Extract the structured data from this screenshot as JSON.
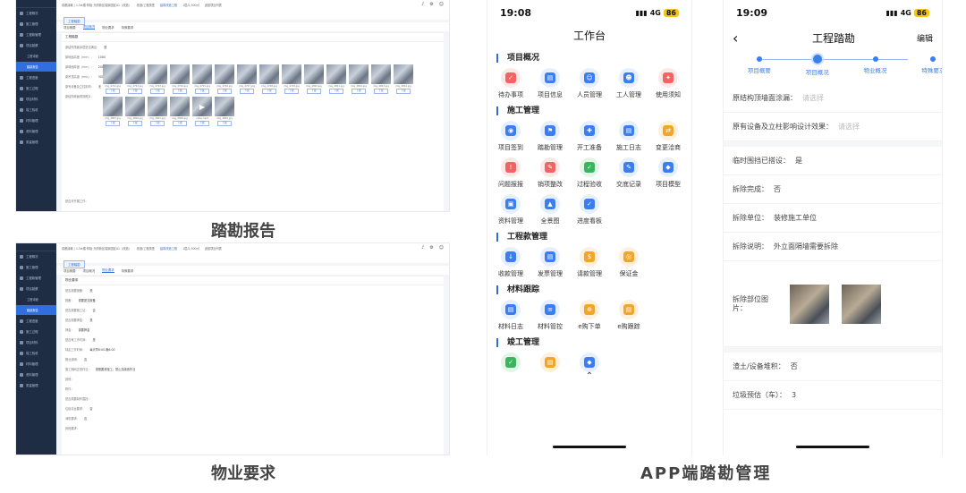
{
  "pc": {
    "sidebar_items": [
      "工程概况",
      "施工管理",
      "工程款管理",
      "项目勘察",
      "工程进度",
      "施工过程",
      "项目材料",
      "竣工验收",
      "材料管理",
      "资料管理",
      "质量管理"
    ],
    "submenu": [
      "工程详细",
      "踏勘报告"
    ],
    "topbar": {
      "project": "成都绿城 | 1-5#楼·样板·天府新区瑞景园区A1（改造）",
      "type_label": "改造/工程类型",
      "type_value": "建筑改造工程",
      "progress": "1层/2,500㎡",
      "back": "返回项目列表"
    },
    "chip": "工程踏勘",
    "tabs": [
      "项目概要",
      "项目概况",
      "物业要求",
      "特殊要求"
    ],
    "report": {
      "section": "工程踏勘",
      "rows": [
        {
          "label": "原结构顶面涂层是否满足：",
          "value": "是"
        },
        {
          "label": "原地面高差（mm）：",
          "value": "1000"
        },
        {
          "label": "原墙面厚度（mm）：",
          "value": "200"
        },
        {
          "label": "原吊顶高度（mm）：",
          "value": "3000"
        },
        {
          "label": "原有设备及立柱影响：",
          "value": "无"
        },
        {
          "label": "原结构墙面现场照片：",
          "value": ""
        }
      ],
      "photo_names": [
        "img_4791.jpg",
        "img_4792.jpg",
        "img_4793.jpg",
        "img_4794.jpg",
        "img_4795.jpg",
        "img_4796.jpg",
        "img_4797.jpg",
        "img_4798.jpg",
        "img_4799.jpg",
        "img_4800.jpg",
        "img_4801.jpg",
        "img_4802.jpg",
        "img_4803.jpg",
        "img_4804.jpg",
        "img_4805.jpg",
        "img_4806.jpg",
        "img_4807.jpg",
        "img_4808.jpg",
        "video.mp4",
        "img_4809.jpg"
      ],
      "photo_tag": "下载",
      "footer": "是否可开展工作："
    },
    "property": {
      "section": "物业要求",
      "rows": [
        {
          "label": "是否需要报备：",
          "value": "是"
        },
        {
          "label": "报备：",
          "value": "需要提交报备"
        },
        {
          "label": "是否需要施工证：",
          "value": "否"
        },
        {
          "label": "是否需要押金：",
          "value": "是"
        },
        {
          "label": "押金：",
          "value": "需要押金"
        },
        {
          "label": "是否有工作时间：",
          "value": "是"
        },
        {
          "label": "特定工作时间：",
          "value": "每天早8:00-晚6:00"
        },
        {
          "label": "物业说明：",
          "value": "否"
        },
        {
          "label": "施工期间正常作业：",
          "value": "按照要求施工，禁止高噪音作业"
        },
        {
          "label": "其他：",
          "value": ""
        },
        {
          "label": "附件：",
          "value": ""
        },
        {
          "label": "是否需要制作围挡：",
          "value": ""
        },
        {
          "label": "垃圾清运要求：",
          "value": "否"
        },
        {
          "label": "消防要求：",
          "value": "否"
        },
        {
          "label": "其他要求：",
          "value": ""
        }
      ]
    }
  },
  "captions": {
    "report": "踏勘报告",
    "property": "物业要求",
    "app": "APP端踏勘管理"
  },
  "phone1": {
    "time": "19:08",
    "network": "4G",
    "battery": "86",
    "title": "工作台",
    "sections": [
      {
        "title": "项目概况",
        "items": [
          {
            "label": "待办事项",
            "color": "red",
            "glyph": "✓"
          },
          {
            "label": "项目信息",
            "color": "blue",
            "glyph": "▤"
          },
          {
            "label": "人员管理",
            "color": "blue",
            "glyph": "☺"
          },
          {
            "label": "工人管理",
            "color": "blue",
            "glyph": "☻"
          },
          {
            "label": "使用须知",
            "color": "red",
            "glyph": "✦"
          }
        ]
      },
      {
        "title": "施工管理",
        "items": [
          {
            "label": "项目签到",
            "color": "blue",
            "glyph": "◉"
          },
          {
            "label": "踏勘管理",
            "color": "blue",
            "glyph": "⚑"
          },
          {
            "label": "开工准备",
            "color": "blue",
            "glyph": "✚"
          },
          {
            "label": "施工日志",
            "color": "blue",
            "glyph": "▤"
          },
          {
            "label": "变更洽商",
            "color": "orange",
            "glyph": "⇄"
          },
          {
            "label": "问题报报",
            "color": "red",
            "glyph": "!"
          },
          {
            "label": "销项整改",
            "color": "red",
            "glyph": "✎"
          },
          {
            "label": "过程验收",
            "color": "green",
            "glyph": "✓"
          },
          {
            "label": "交底记录",
            "color": "blue",
            "glyph": "✎"
          },
          {
            "label": "项目模型",
            "color": "blue",
            "glyph": "◆"
          },
          {
            "label": "资料管理",
            "color": "blue",
            "glyph": "▣"
          },
          {
            "label": "全景图",
            "color": "blue",
            "glyph": "▲"
          },
          {
            "label": "进度看板",
            "color": "blue",
            "glyph": "✓"
          }
        ]
      },
      {
        "title": "工程款管理",
        "items": [
          {
            "label": "收款管理",
            "color": "blue",
            "glyph": "↓"
          },
          {
            "label": "发票管理",
            "color": "blue",
            "glyph": "▤"
          },
          {
            "label": "请款管理",
            "color": "orange",
            "glyph": "$"
          },
          {
            "label": "保证金",
            "color": "orange",
            "glyph": "◎"
          }
        ]
      },
      {
        "title": "材料跟踪",
        "items": [
          {
            "label": "材料日志",
            "color": "blue",
            "glyph": "▤"
          },
          {
            "label": "材料管控",
            "color": "blue",
            "glyph": "≡"
          },
          {
            "label": "e购下单",
            "color": "orange",
            "glyph": "⊕"
          },
          {
            "label": "e购跟踪",
            "color": "orange",
            "glyph": "▤"
          }
        ]
      },
      {
        "title": "竣工管理",
        "items": [
          {
            "label": "",
            "color": "green",
            "glyph": "✓"
          },
          {
            "label": "",
            "color": "orange",
            "glyph": "▤"
          },
          {
            "label": "",
            "color": "blue",
            "glyph": "◆"
          }
        ]
      }
    ]
  },
  "phone2": {
    "time": "19:09",
    "network": "4G",
    "battery": "86",
    "title": "工程踏勘",
    "edit": "编辑",
    "steps": [
      "项目概要",
      "项目概况",
      "物业概况",
      "特殊要求"
    ],
    "fields": [
      {
        "label": "原结构顶墙面涂漏：",
        "value": "请选择",
        "placeholder": true
      },
      {
        "label": "原有设备及立柱影响设计效果：",
        "value": "请选择",
        "placeholder": true
      },
      {
        "label": "临时围挡已搭设：",
        "value": "是"
      },
      {
        "label": "拆除完成：",
        "value": "否"
      },
      {
        "label": "拆除单位：",
        "value": "装修施工单位"
      },
      {
        "label": "拆除说明：",
        "value": "外立面隔墙需要拆除"
      }
    ],
    "photo_label": "拆除部位图片：",
    "fields_after": [
      {
        "label": "渣土/设备堆积：",
        "value": "否"
      },
      {
        "label": "垃圾预估（车）：",
        "value": "3"
      }
    ]
  }
}
